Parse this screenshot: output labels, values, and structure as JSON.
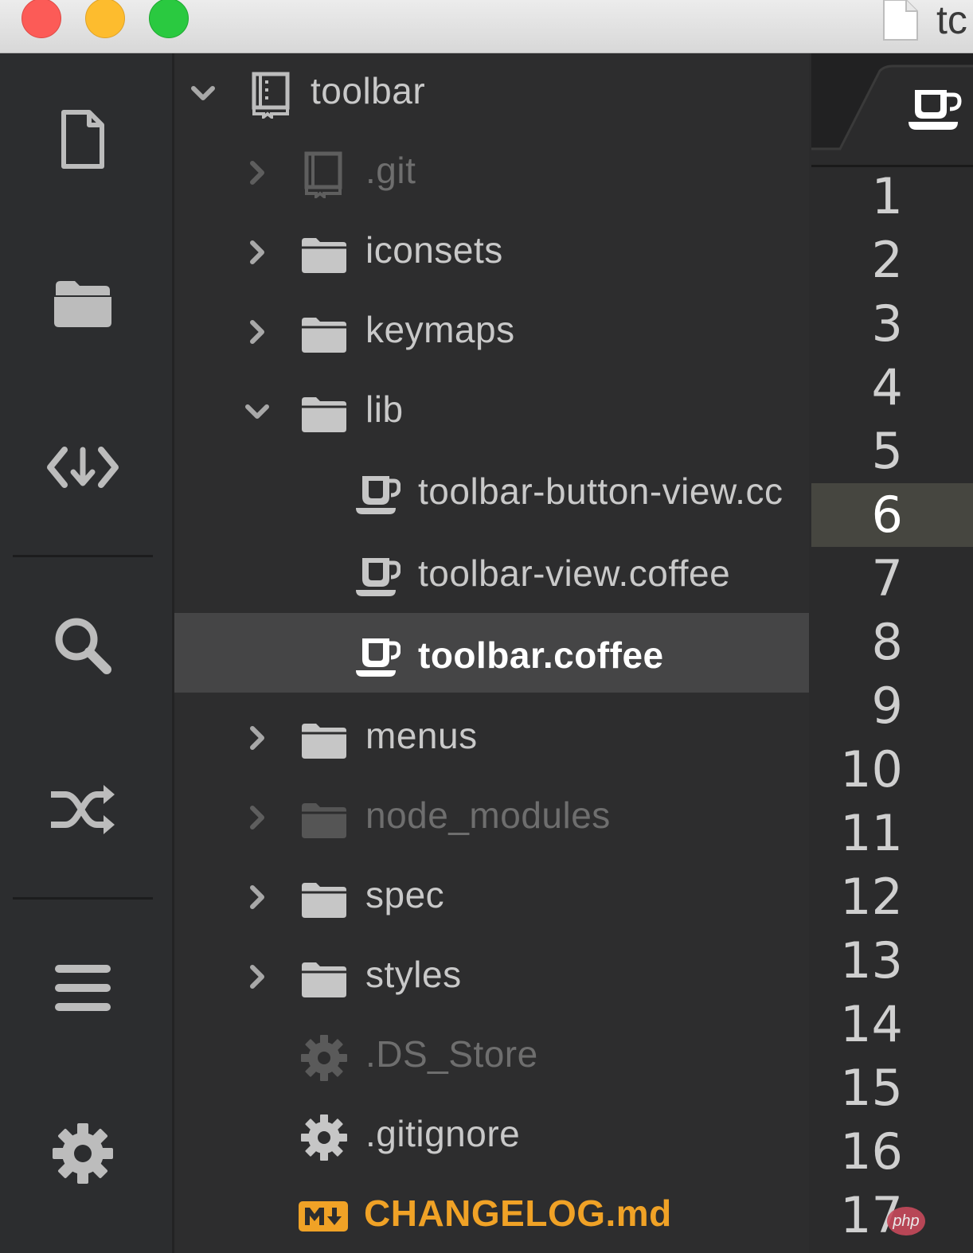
{
  "window": {
    "title": "tc",
    "controls": [
      "close",
      "minimize",
      "maximize"
    ]
  },
  "iconbar": {
    "items": [
      {
        "name": "file-icon"
      },
      {
        "name": "folder-icon"
      },
      {
        "name": "git-diff-icon"
      },
      {
        "name": "search-icon"
      },
      {
        "name": "shuffle-icon"
      },
      {
        "name": "menu-icon"
      },
      {
        "name": "settings-icon"
      }
    ]
  },
  "tree": {
    "root": {
      "label": "toolbar",
      "icon": "repo-icon",
      "expanded": true
    },
    "items": [
      {
        "label": ".git",
        "icon": "repo-icon",
        "kind": "folder",
        "expanded": false,
        "dimmed": true
      },
      {
        "label": "iconsets",
        "icon": "folder-icon",
        "kind": "folder",
        "expanded": false
      },
      {
        "label": "keymaps",
        "icon": "folder-icon",
        "kind": "folder",
        "expanded": false
      },
      {
        "label": "lib",
        "icon": "folder-icon",
        "kind": "folder",
        "expanded": true
      },
      {
        "label": "toolbar-button-view.cc",
        "icon": "coffee-icon",
        "kind": "file",
        "indent": 2
      },
      {
        "label": "toolbar-view.coffee",
        "icon": "coffee-icon",
        "kind": "file",
        "indent": 2
      },
      {
        "label": "toolbar.coffee",
        "icon": "coffee-icon",
        "kind": "file",
        "indent": 2,
        "selected": true
      },
      {
        "label": "menus",
        "icon": "folder-icon",
        "kind": "folder",
        "expanded": false
      },
      {
        "label": "node_modules",
        "icon": "folder-icon",
        "kind": "folder",
        "expanded": false,
        "dimmed": true
      },
      {
        "label": "spec",
        "icon": "folder-icon",
        "kind": "folder",
        "expanded": false
      },
      {
        "label": "styles",
        "icon": "folder-icon",
        "kind": "folder",
        "expanded": false
      },
      {
        "label": ".DS_Store",
        "icon": "gear-icon",
        "kind": "file",
        "dimmed": true
      },
      {
        "label": ".gitignore",
        "icon": "gear-icon",
        "kind": "file"
      },
      {
        "label": "CHANGELOG.md",
        "icon": "markdown-icon",
        "kind": "file",
        "markdown": true
      }
    ]
  },
  "editor": {
    "tab_icon": "coffee-icon",
    "line_numbers": [
      "1",
      "2",
      "3",
      "4",
      "5",
      "6",
      "7",
      "8",
      "9",
      "10",
      "11",
      "12",
      "13",
      "14",
      "15",
      "16",
      "17"
    ],
    "current_line": 6
  },
  "watermark": {
    "text": "php"
  },
  "colors": {
    "markdown_accent": "#f0a226",
    "selected_row": "#454546",
    "current_line_bg": "#464640"
  }
}
